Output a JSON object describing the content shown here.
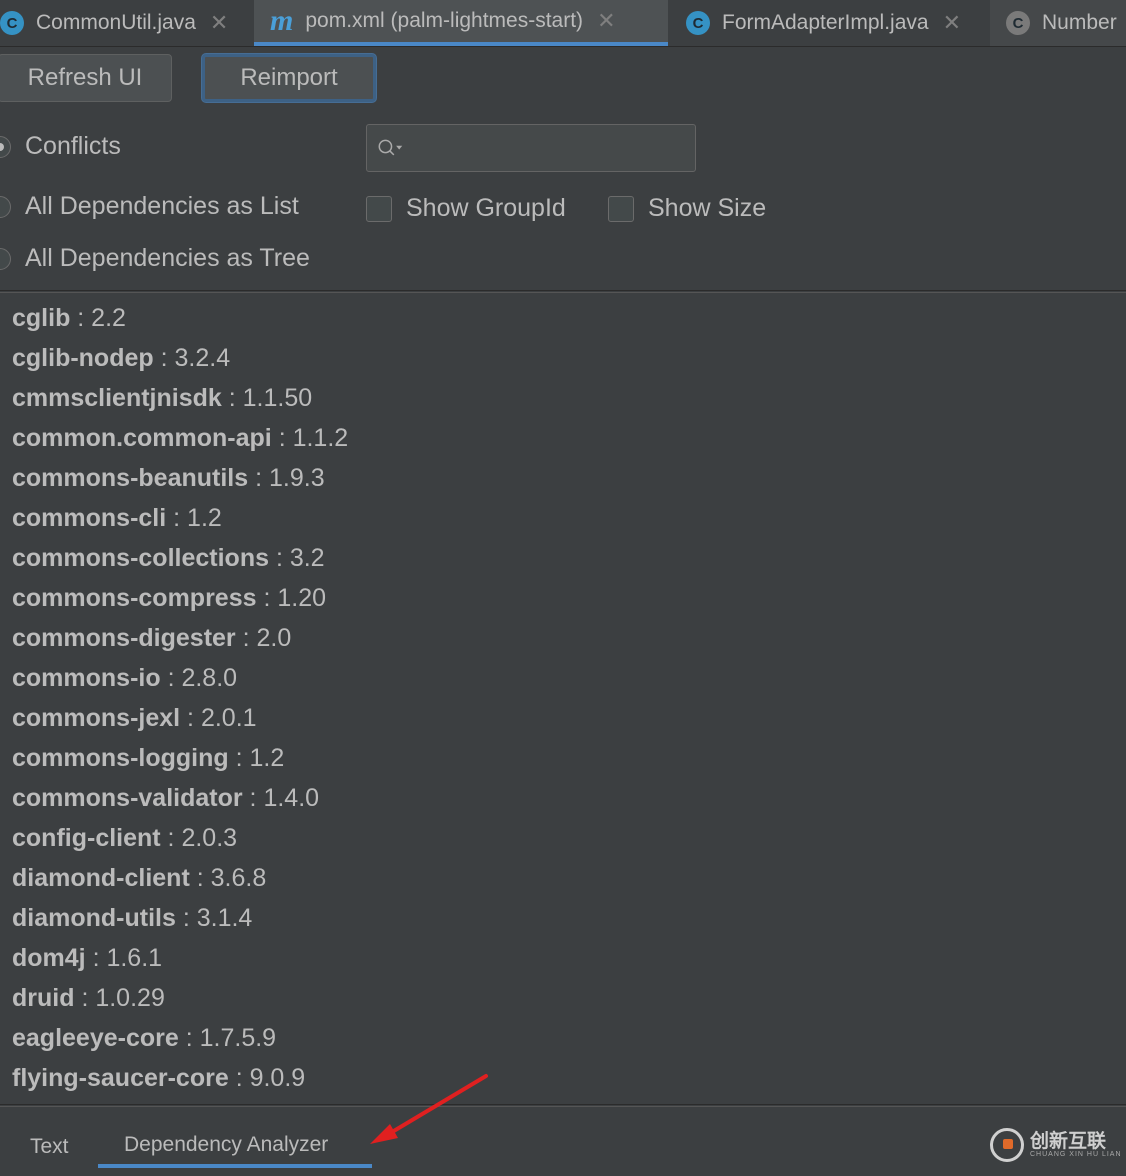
{
  "tabs": [
    {
      "icon": "class-c-icon",
      "label": "CommonUtil.java"
    },
    {
      "icon": "maven-m-icon",
      "label": "pom.xml (palm-lightmes-start)"
    },
    {
      "icon": "class-c-icon",
      "label": "FormAdapterImpl.java"
    },
    {
      "icon": "locked-class-c-icon",
      "label": "Number"
    }
  ],
  "toolbar": {
    "refresh_label": "Refresh UI",
    "reimport_label": "Reimport"
  },
  "view_modes": {
    "conflicts": "Conflicts",
    "list": "All Dependencies as List",
    "tree": "All Dependencies as Tree"
  },
  "options": {
    "show_groupid": "Show GroupId",
    "show_size": "Show Size"
  },
  "search": {
    "value": ""
  },
  "dependencies": [
    {
      "name": "cglib",
      "version": " : 2.2"
    },
    {
      "name": "cglib-nodep",
      "version": " : 3.2.4"
    },
    {
      "name": "cmmsclientjnisdk",
      "version": " : 1.1.50"
    },
    {
      "name": "common.common-api",
      "version": " : 1.1.2"
    },
    {
      "name": "commons-beanutils",
      "version": " : 1.9.3"
    },
    {
      "name": "commons-cli",
      "version": " : 1.2"
    },
    {
      "name": "commons-collections",
      "version": " : 3.2"
    },
    {
      "name": "commons-compress",
      "version": " : 1.20"
    },
    {
      "name": "commons-digester",
      "version": " : 2.0"
    },
    {
      "name": "commons-io",
      "version": " : 2.8.0"
    },
    {
      "name": "commons-jexl",
      "version": " : 2.0.1"
    },
    {
      "name": "commons-logging",
      "version": " : 1.2"
    },
    {
      "name": "commons-validator",
      "version": " : 1.4.0"
    },
    {
      "name": "config-client",
      "version": " : 2.0.3"
    },
    {
      "name": "diamond-client",
      "version": " : 3.6.8"
    },
    {
      "name": "diamond-utils",
      "version": " : 3.1.4"
    },
    {
      "name": "dom4j",
      "version": " : 1.6.1"
    },
    {
      "name": "druid",
      "version": " : 1.0.29"
    },
    {
      "name": "eagleeye-core",
      "version": " : 1.7.5.9"
    },
    {
      "name": "flying-saucer-core",
      "version": " : 9.0.9"
    }
  ],
  "bottom_tabs": {
    "text": "Text",
    "analyzer": "Dependency Analyzer"
  },
  "watermark": {
    "text": "创新互联",
    "sub": "CHUANG XIN HU LIAN"
  },
  "colors": {
    "accent": "#4a88c7",
    "annotation_arrow": "#e02020"
  }
}
